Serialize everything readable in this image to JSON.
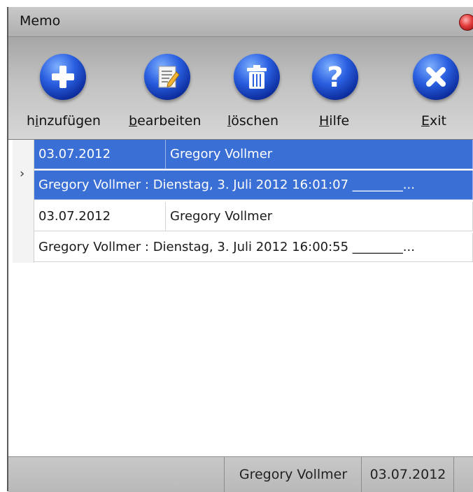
{
  "window": {
    "title": "Memo"
  },
  "toolbar": {
    "buttons": [
      {
        "pre": "h",
        "accel": "i",
        "post": "nzufügen",
        "icon": "add-icon"
      },
      {
        "pre": "",
        "accel": "b",
        "post": "earbeiten",
        "icon": "edit-note-icon"
      },
      {
        "pre": "",
        "accel": "l",
        "post": "öschen",
        "icon": "trash-icon"
      },
      {
        "pre": "",
        "accel": "H",
        "post": "ilfe",
        "icon": "help-icon"
      },
      {
        "pre": "",
        "accel": "E",
        "post": "xit",
        "icon": "close-icon"
      }
    ]
  },
  "grid": {
    "current_row_indicator": "›",
    "records": [
      {
        "date": "03.07.2012",
        "author": "Gregory Vollmer",
        "text": "Gregory Vollmer : Dienstag, 3. Juli 2012 16:01:07 ________...",
        "selected": true
      },
      {
        "date": "03.07.2012",
        "author": "Gregory Vollmer",
        "text": "Gregory Vollmer : Dienstag, 3. Juli 2012 16:00:55 ________...",
        "selected": false
      }
    ]
  },
  "status": {
    "user": "Gregory Vollmer",
    "date": "03.07.2012"
  },
  "colors": {
    "selection": "#3a6fd6",
    "toolbar_icon": "#2a5fe0",
    "close_dot": "#e23b3b"
  }
}
